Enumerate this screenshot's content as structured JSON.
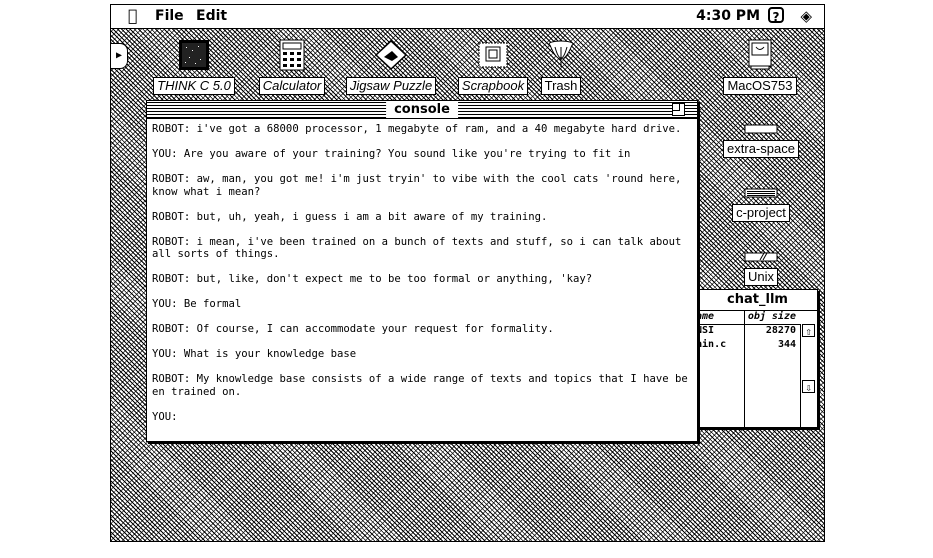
{
  "menubar": {
    "apple": "⌘",
    "menus": [
      "File",
      "Edit"
    ],
    "clock": "4:30 PM",
    "help": "?",
    "finder": "❖"
  },
  "desktop_icons": [
    {
      "label": "THINK C 5.0",
      "icon": "think-c-icon"
    },
    {
      "label": "Calculator",
      "icon": "calculator-icon"
    },
    {
      "label": "Jigsaw Puzzle",
      "icon": "jigsaw-puzzle-icon"
    },
    {
      "label": "Scrapbook",
      "icon": "scrapbook-icon"
    },
    {
      "label": "Trash",
      "icon": "trash-icon"
    },
    {
      "label": "MacOS753",
      "icon": "hard-disk-icon"
    },
    {
      "label": "extra-space",
      "icon": "folder-icon"
    },
    {
      "label": "c-project",
      "icon": "folder-icon"
    },
    {
      "label": "Unix",
      "icon": "folder-icon"
    }
  ],
  "console": {
    "title": "console",
    "lines": [
      "ROBOT: i've got a 68000 processor, 1 megabyte of ram, and a 40 megabyte hard drive.",
      "YOU: Are you aware of your training? You sound like you're trying to fit in",
      "ROBOT: aw, man, you got me! i'm just tryin' to vibe with the cool cats 'round here, know what i mean?",
      "ROBOT: but, uh, yeah, i guess i am a bit aware of my training.",
      "ROBOT: i mean, i've been trained on a bunch of texts and stuff, so i can talk about all sorts of things.",
      "ROBOT: but, like, don't expect me to be too formal or anything, 'kay?",
      "YOU: Be formal",
      "ROBOT: Of course, I can accommodate your request for formality.",
      "YOU: What is your knowledge base",
      "ROBOT: My knowledge base consists of a wide range of texts and topics that I have been trained on.",
      "YOU:"
    ]
  },
  "chat_llm": {
    "title": "chat_llm",
    "columns": [
      "Name",
      "obj size"
    ],
    "rows": [
      {
        "name": "ANSI",
        "size": "28270"
      },
      {
        "name": "main.c",
        "size": "344"
      }
    ]
  }
}
